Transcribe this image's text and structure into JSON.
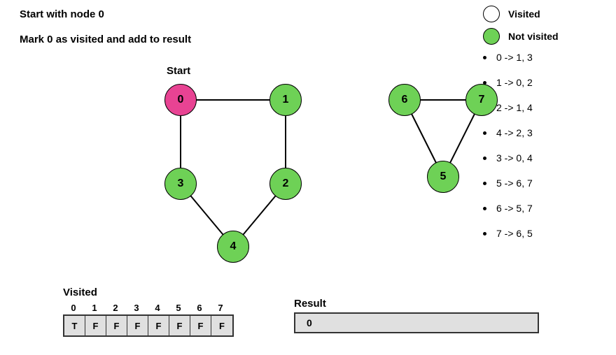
{
  "title_line1": "Start with node 0",
  "title_line2": "Mark 0 as visited and add to result",
  "legend": {
    "visited": {
      "label": "Visited",
      "color": "#e84393"
    },
    "not_visited": {
      "label": "Not visited",
      "color": "#6ed156"
    }
  },
  "adjacency": [
    "0 -> 1, 3",
    "1 -> 0, 2",
    "2 -> 1, 4",
    "4 -> 2, 3",
    "3 -> 0, 4",
    "5 -> 6, 7",
    "6 -> 5, 7",
    "7 -> 6, 5"
  ],
  "start_label": "Start",
  "nodes": {
    "n0": {
      "label": "0",
      "visited": true
    },
    "n1": {
      "label": "1",
      "visited": false
    },
    "n2": {
      "label": "2",
      "visited": false
    },
    "n3": {
      "label": "3",
      "visited": false
    },
    "n4": {
      "label": "4",
      "visited": false
    },
    "n5": {
      "label": "5",
      "visited": false
    },
    "n6": {
      "label": "6",
      "visited": false
    },
    "n7": {
      "label": "7",
      "visited": false
    }
  },
  "visited_section": {
    "title": "Visited",
    "headers": [
      "0",
      "1",
      "2",
      "3",
      "4",
      "5",
      "6",
      "7"
    ],
    "values": [
      "T",
      "F",
      "F",
      "F",
      "F",
      "F",
      "F",
      "F"
    ]
  },
  "result_section": {
    "title": "Result",
    "value": "0"
  },
  "chart_data": {
    "type": "diagram",
    "graph": {
      "nodes": [
        0,
        1,
        2,
        3,
        4,
        5,
        6,
        7
      ],
      "edges": [
        [
          0,
          1
        ],
        [
          0,
          3
        ],
        [
          1,
          2
        ],
        [
          2,
          4
        ],
        [
          3,
          4
        ],
        [
          6,
          7
        ],
        [
          6,
          5
        ],
        [
          7,
          5
        ]
      ],
      "start_node": 0,
      "visited_nodes": [
        0
      ],
      "not_visited_nodes": [
        1,
        2,
        3,
        4,
        5,
        6,
        7
      ]
    },
    "adjacency_list": {
      "0": [
        1,
        3
      ],
      "1": [
        0,
        2
      ],
      "2": [
        1,
        4
      ],
      "4": [
        2,
        3
      ],
      "3": [
        0,
        4
      ],
      "5": [
        6,
        7
      ],
      "6": [
        5,
        7
      ],
      "7": [
        6,
        5
      ]
    },
    "visited_array": {
      "0": "T",
      "1": "F",
      "2": "F",
      "3": "F",
      "4": "F",
      "5": "F",
      "6": "F",
      "7": "F"
    },
    "result": [
      0
    ],
    "colors": {
      "visited": "#e84393",
      "not_visited": "#6ed156"
    }
  }
}
